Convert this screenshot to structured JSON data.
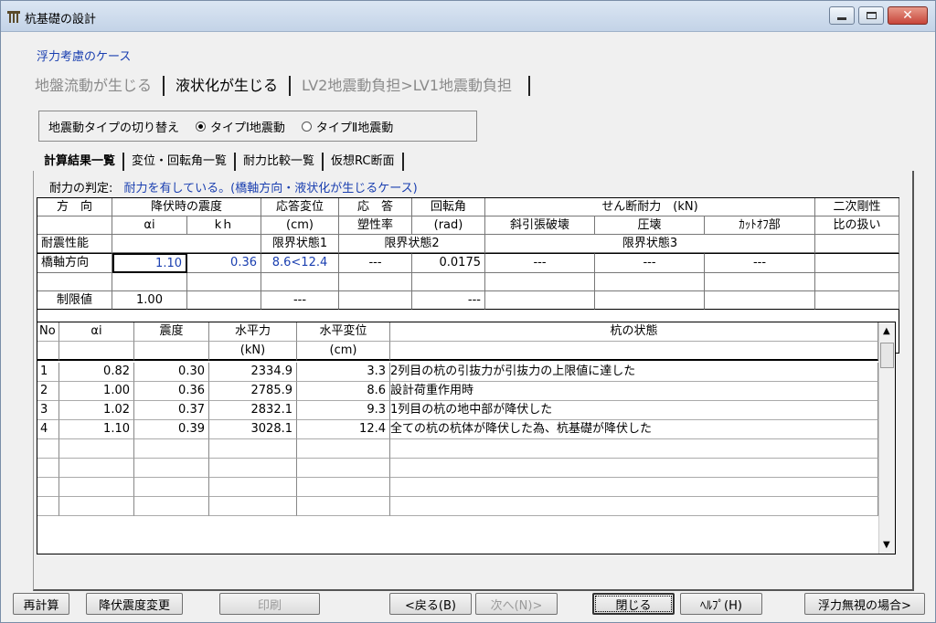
{
  "window": {
    "title": "杭基礎の設計",
    "icon": "app-icon"
  },
  "case_label": "浮力考慮のケース",
  "outer_tabs": [
    "地盤流動が生じる",
    "液状化が生じる",
    "LV2地震動負担>LV1地震動負担"
  ],
  "quake_type": {
    "label": "地震動タイプの切り替え",
    "opt1": "タイプⅠ地震動",
    "opt2": "タイプⅡ地震動",
    "selected": "タイプⅠ地震動"
  },
  "inner_tabs": [
    "計算結果一覧",
    "変位・回転角一覧",
    "耐力比較一覧",
    "仮想RC断面"
  ],
  "judgement": {
    "label": "耐力の判定:",
    "value": "耐力を有している。(橋軸方向・液状化が生じるケース)"
  },
  "summary": {
    "h_dir": "方　向",
    "h_yield": "降伏時の震度",
    "h_resp": "応答変位",
    "h_resp2": "応　答",
    "h_rot": "回転角",
    "h_shear": "せん断耐力　(kN)",
    "h_second": "二次剛性",
    "h_ai": "αi",
    "h_kh": "kｈ",
    "h_cm": "(cm)",
    "h_plast": "塑性率",
    "h_rad": "(rad)",
    "h_diag": "斜引張破壊",
    "h_comp": "圧壊",
    "h_cut": "ｶｯﾄｵﾌ部",
    "h_ratio": "比の扱い",
    "h_perf": "耐震性能",
    "h_ls1": "限界状態1",
    "h_ls2": "限界状態2",
    "h_ls3": "限界状態3",
    "row_label": "橋軸方向",
    "ai": "1.10",
    "kh": "0.36",
    "resp": "8.6<12.4",
    "plast": "---",
    "rot": "0.0175",
    "diag": "---",
    "comp": "---",
    "cut": "---",
    "limit_label": "制限値",
    "limit_ai": "1.00",
    "limit_resp": "---",
    "limit_rot": "---"
  },
  "list": {
    "headers": {
      "no": "No",
      "ai": "αi",
      "k": "震度",
      "h": "水平力",
      "d": "水平変位",
      "state": "杭の状態",
      "h_unit": "(kN)",
      "d_unit": "(cm)"
    },
    "rows": [
      {
        "no": "1",
        "ai": "0.82",
        "k": "0.30",
        "h": "2334.9",
        "d": "3.3",
        "state": "2列目の杭の引抜力が引抜力の上限値に達した"
      },
      {
        "no": "2",
        "ai": "1.00",
        "k": "0.36",
        "h": "2785.9",
        "d": "8.6",
        "state": "設計荷重作用時"
      },
      {
        "no": "3",
        "ai": "1.02",
        "k": "0.37",
        "h": "2832.1",
        "d": "9.3",
        "state": "1列目の杭の地中部が降伏した"
      },
      {
        "no": "4",
        "ai": "1.10",
        "k": "0.39",
        "h": "3028.1",
        "d": "12.4",
        "state": "全ての杭の杭体が降伏した為、杭基礎が降伏した"
      }
    ]
  },
  "buttons": {
    "recalc": "再計算",
    "yield_change": "降伏震度変更",
    "print": "印刷",
    "back": "<戻る(B)",
    "next": "次へ(N)>",
    "close": "閉じる",
    "help": "ﾍﾙﾌﾟ(H)",
    "ignore": "浮力無視の場合>"
  },
  "colors": {
    "accent": "#1a3fb0",
    "window_bg": "#f0f0f0"
  }
}
